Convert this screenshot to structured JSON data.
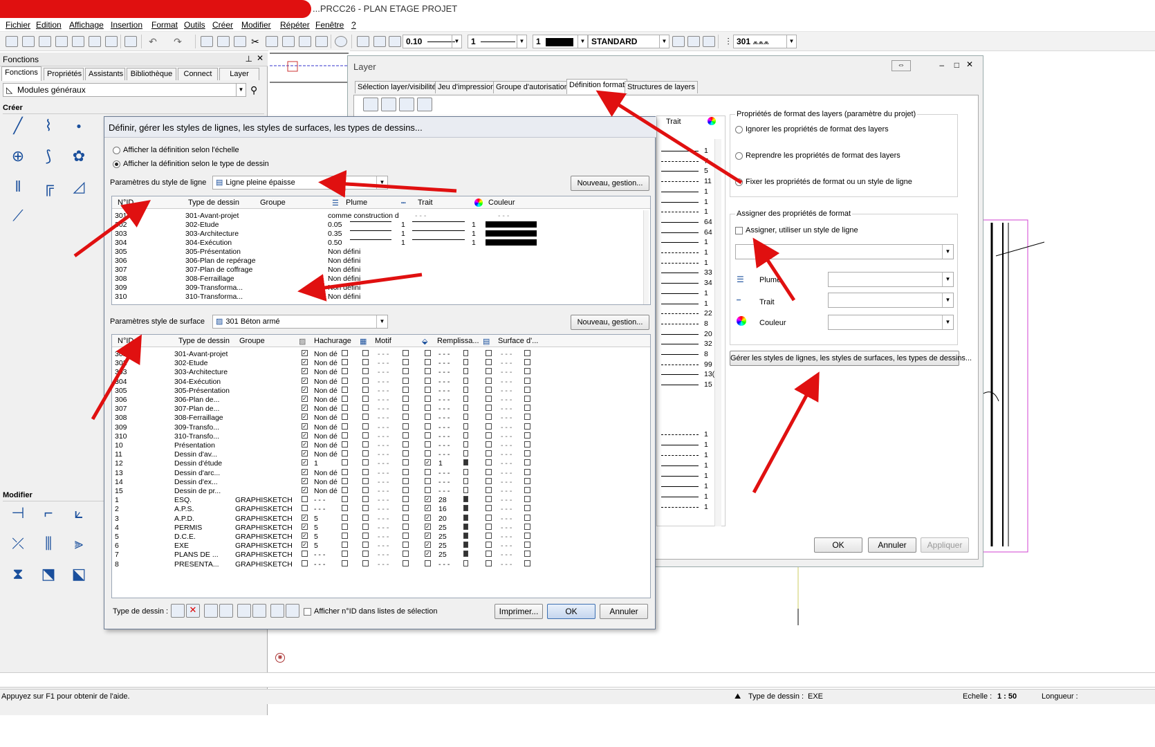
{
  "window": {
    "title": "...PRCC26 - PLAN ETAGE PROJET"
  },
  "menu": [
    "Fichier",
    "Edition",
    "Affichage",
    "Insertion",
    "Format",
    "Outils",
    "Créer",
    "Modifier",
    "Répéter",
    "Fenêtre",
    "?"
  ],
  "toolbar": {
    "pen_value": "0.10",
    "line_value": "1",
    "color_value": "1",
    "layer_value": "STANDARD",
    "drawtype_value": "301"
  },
  "left_panel": {
    "header": "Fonctions",
    "tabs": [
      "Fonctions",
      "Propriétés",
      "Assistants",
      "Bibliothèque",
      "Connect",
      "Layer"
    ],
    "module": "Modules généraux",
    "create_label": "Créer",
    "modify_label": "Modifier"
  },
  "layer_window": {
    "title": "Layer",
    "tabs": [
      "Sélection layer/visibilité",
      "Jeu d'impression",
      "Groupe d'autorisation",
      "Définition format",
      "Structures de layers"
    ],
    "trait_header": "Trait",
    "format_group": "Propriétés de format des layers (paramètre du projet)",
    "radio_options": [
      "Ignorer les propriétés de format des layers",
      "Reprendre les propriétés de format des layers",
      "Fixer les propriétés de format ou un style de ligne"
    ],
    "assign_group": "Assigner des propriétés de format",
    "assign_check": "Assigner, utiliser un style de ligne",
    "plume_label": "Plume",
    "trait_label": "Trait",
    "couleur_label": "Couleur",
    "manage_button": "Gérer les styles de lignes, les styles de surfaces, les types de dessins...",
    "ok": "OK",
    "cancel": "Annuler",
    "apply": "Appliquer",
    "number_column": [
      "1",
      "7",
      "5",
      "11",
      "1",
      "1",
      "1",
      "64",
      "64",
      "1",
      "1",
      "1",
      "33",
      "34",
      "1",
      "1",
      "22",
      "8",
      "20",
      "32",
      "8",
      "99",
      "13(",
      "15",
      "1",
      "1",
      "1",
      "1",
      "1",
      "1",
      "1",
      "1"
    ]
  },
  "dialog": {
    "title": "Définir, gérer les styles de lignes, les styles de surfaces, les types de dessins...",
    "radio_scale": "Afficher la définition selon l'échelle",
    "radio_type": "Afficher la définition selon le type de dessin",
    "line_style_label": "Paramètres du style de ligne",
    "line_style_value": "Ligne pleine épaisse",
    "new_button": "Nouveau, gestion...",
    "line_headers": [
      "N°ID",
      "Type de dessin",
      "Groupe",
      "Plume",
      "Trait",
      "Couleur"
    ],
    "line_rows": [
      {
        "id": "301",
        "type": "301-Avant-projet",
        "plume": "comme construction d",
        "trait": "- - -",
        "color": "- - -"
      },
      {
        "id": "302",
        "type": "302-Etude",
        "plume": "0.05",
        "trait": "1",
        "color": "1"
      },
      {
        "id": "303",
        "type": "303-Architecture",
        "plume": "0.35",
        "trait": "1",
        "color": "1"
      },
      {
        "id": "304",
        "type": "304-Exécution",
        "plume": "0.50",
        "trait": "1",
        "color": "1"
      },
      {
        "id": "305",
        "type": "305-Présentation",
        "plume": "Non défini",
        "trait": "",
        "color": ""
      },
      {
        "id": "306",
        "type": "306-Plan de repérage",
        "plume": "Non défini",
        "trait": "",
        "color": ""
      },
      {
        "id": "307",
        "type": "307-Plan de coffrage",
        "plume": "Non défini",
        "trait": "",
        "color": ""
      },
      {
        "id": "308",
        "type": "308-Ferraillage",
        "plume": "Non défini",
        "trait": "",
        "color": ""
      },
      {
        "id": "309",
        "type": "309-Transforma...",
        "plume": "Non défini",
        "trait": "",
        "color": ""
      },
      {
        "id": "310",
        "type": "310-Transforma...",
        "plume": "Non défini",
        "trait": "",
        "color": ""
      }
    ],
    "surface_style_label": "Paramètres style de surface",
    "surface_style_value": "301 Béton armé",
    "surface_headers": [
      "N°ID",
      "Type de dessin",
      "Groupe",
      "Hachurage",
      "Motif",
      "Remplissa...",
      "Surface d'..."
    ],
    "surface_rows": [
      {
        "id": "301",
        "type": "301-Avant-projet",
        "group": "",
        "h": "Non dé",
        "r": "- - -"
      },
      {
        "id": "302",
        "type": "302-Etude",
        "group": "",
        "h": "Non dé",
        "r": "- - -"
      },
      {
        "id": "303",
        "type": "303-Architecture",
        "group": "",
        "h": "Non dé",
        "r": "- - -"
      },
      {
        "id": "304",
        "type": "304-Exécution",
        "group": "",
        "h": "Non dé",
        "r": "- - -"
      },
      {
        "id": "305",
        "type": "305-Présentation",
        "group": "",
        "h": "Non dé",
        "r": "- - -"
      },
      {
        "id": "306",
        "type": "306-Plan de...",
        "group": "",
        "h": "Non dé",
        "r": "- - -"
      },
      {
        "id": "307",
        "type": "307-Plan de...",
        "group": "",
        "h": "Non dé",
        "r": "- - -"
      },
      {
        "id": "308",
        "type": "308-Ferraillage",
        "group": "",
        "h": "Non dé",
        "r": "- - -"
      },
      {
        "id": "309",
        "type": "309-Transfo...",
        "group": "",
        "h": "Non dé",
        "r": "- - -"
      },
      {
        "id": "310",
        "type": "310-Transfo...",
        "group": "",
        "h": "Non dé",
        "r": "- - -"
      },
      {
        "id": "10",
        "type": "Présentation",
        "group": "",
        "h": "Non dé",
        "r": "- - -"
      },
      {
        "id": "11",
        "type": "Dessin d'av...",
        "group": "",
        "h": "Non dé",
        "r": "- - -"
      },
      {
        "id": "12",
        "type": "Dessin d'étude",
        "group": "",
        "h": "1",
        "r": "1"
      },
      {
        "id": "13",
        "type": "Dessin d'arc...",
        "group": "",
        "h": "Non dé",
        "r": "- - -"
      },
      {
        "id": "14",
        "type": "Dessin d'ex...",
        "group": "",
        "h": "Non dé",
        "r": "- - -"
      },
      {
        "id": "15",
        "type": "Dessin de pr...",
        "group": "",
        "h": "Non dé",
        "r": "- - -"
      },
      {
        "id": "1",
        "type": "ESQ.",
        "group": "GRAPHISKETCH",
        "h": "- - -",
        "r": "28"
      },
      {
        "id": "2",
        "type": "A.P.S.",
        "group": "GRAPHISKETCH",
        "h": "- - -",
        "r": "16"
      },
      {
        "id": "3",
        "type": "A.P.D.",
        "group": "GRAPHISKETCH",
        "h": "5",
        "r": "20"
      },
      {
        "id": "4",
        "type": "PERMIS",
        "group": "GRAPHISKETCH",
        "h": "5",
        "r": "25"
      },
      {
        "id": "5",
        "type": "D.C.E.",
        "group": "GRAPHISKETCH",
        "h": "5",
        "r": "25"
      },
      {
        "id": "6",
        "type": "EXE",
        "group": "GRAPHISKETCH",
        "h": "5",
        "r": "25"
      },
      {
        "id": "7",
        "type": "PLANS DE ...",
        "group": "GRAPHISKETCH",
        "h": "- - -",
        "r": "25"
      },
      {
        "id": "8",
        "type": "PRESENTA...",
        "group": "GRAPHISKETCH",
        "h": "- - -",
        "r": "- - -"
      }
    ],
    "type_label": "Type de dessin :",
    "show_id_check": "Afficher n°ID dans listes de sélection",
    "print_button": "Imprimer...",
    "ok": "OK",
    "cancel": "Annuler"
  },
  "statusbar": {
    "help": "Appuyez sur F1 pour obtenir de l'aide.",
    "drawtype_label": "Type de dessin :",
    "drawtype_value": "EXE",
    "scale_label": "Echelle :",
    "scale_value": "1 : 50",
    "length_label": "Longueur :"
  },
  "colors": {
    "accent": "#3c6fb0",
    "arrow": "#e01010",
    "selected_tab": "#ffffff"
  }
}
